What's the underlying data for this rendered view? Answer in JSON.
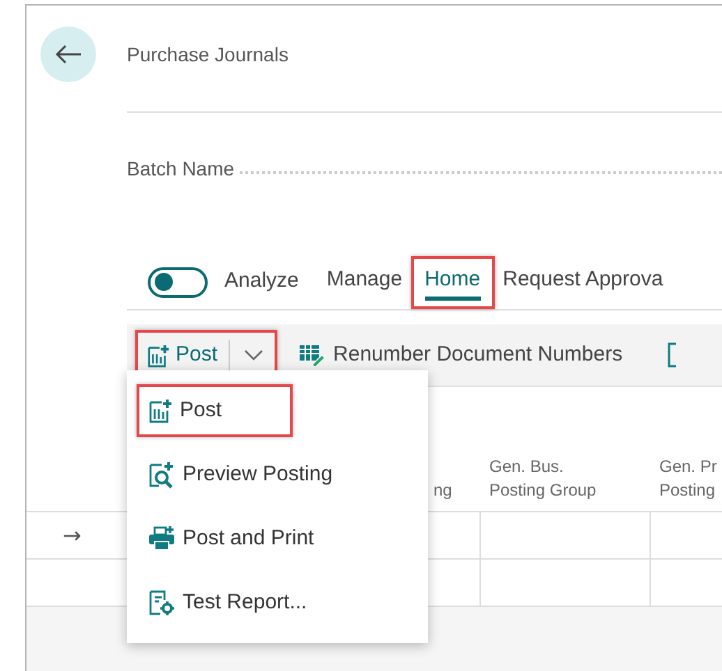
{
  "page": {
    "title": "Purchase Journals"
  },
  "batch_name": {
    "label": "Batch Name"
  },
  "analyze_toggle": {
    "label": "Analyze",
    "on": false
  },
  "tabs": [
    {
      "label": "Manage",
      "selected": false,
      "highlighted": false
    },
    {
      "label": "Home",
      "selected": true,
      "highlighted": true
    },
    {
      "label": "Request Approva",
      "selected": false,
      "highlighted": false
    }
  ],
  "toolbar": {
    "post_button": {
      "label": "Post",
      "highlighted": true
    },
    "actions": [
      {
        "label": "Renumber Document Numbers"
      }
    ]
  },
  "dropdown_menu": [
    {
      "label": "Post",
      "kind": "post",
      "highlighted": true
    },
    {
      "label": "Preview Posting",
      "kind": "preview",
      "highlighted": false
    },
    {
      "label": "Post and Print",
      "kind": "print",
      "highlighted": false
    },
    {
      "label": "Test Report...",
      "kind": "report",
      "highlighted": false
    }
  ],
  "table": {
    "columns": [
      {
        "lines": [
          "ng"
        ]
      },
      {
        "lines": [
          "Gen. Bus.",
          "Posting Group"
        ]
      },
      {
        "lines": [
          "Gen. Pr",
          "Posting"
        ]
      }
    ],
    "rows": [
      {
        "marker": "→"
      },
      {}
    ]
  }
}
